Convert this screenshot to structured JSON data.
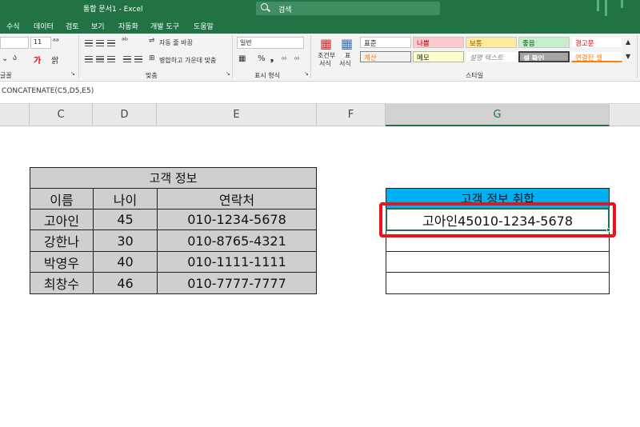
{
  "window": {
    "title": "통합 문서1 - Excel",
    "search_placeholder": "검색"
  },
  "menu": {
    "items": [
      "수식",
      "데이터",
      "검토",
      "보기",
      "자동화",
      "개발 도구",
      "도움말"
    ]
  },
  "ribbon": {
    "font_size": "11",
    "wrap_text": "자동 줄 바꿈",
    "merge_center": "병합하고 가운데 맞춤",
    "number_format": "일반",
    "group_font": "글꼴",
    "group_align": "맞춤",
    "group_number": "표시 형식",
    "group_styles": "스타일",
    "cond_format_1": "조건부",
    "cond_format_2": "서식",
    "table_format_1": "표",
    "table_format_2": "서식",
    "styles": {
      "normal": "표준",
      "bad": "나쁨",
      "neutral": "보통",
      "good": "좋음",
      "warning": "경고문",
      "calc": "계산",
      "note": "메모",
      "explanatory": "설명 텍스트",
      "check": "셀 확인",
      "linked": "연결된 셀"
    }
  },
  "formula_bar": {
    "formula": "CONCATENATE(C5,D5,E5)"
  },
  "columns": [
    "C",
    "D",
    "E",
    "F",
    "G"
  ],
  "customer_table": {
    "title": "고객 정보",
    "headers": [
      "이름",
      "나이",
      "연락처"
    ],
    "rows": [
      [
        "고아인",
        "45",
        "010-1234-5678"
      ],
      [
        "강한나",
        "30",
        "010-8765-4321"
      ],
      [
        "박영우",
        "40",
        "010-1111-1111"
      ],
      [
        "최창수",
        "46",
        "010-7777-7777"
      ]
    ]
  },
  "result_table": {
    "title": "고객 정보 취합",
    "values": [
      "고아인45010-1234-5678",
      "",
      "",
      ""
    ]
  },
  "colors": {
    "excel_green": "#217346",
    "header_fill": "#d0cece",
    "result_header_fill": "#00b0f0",
    "highlight": "#e8141b"
  }
}
